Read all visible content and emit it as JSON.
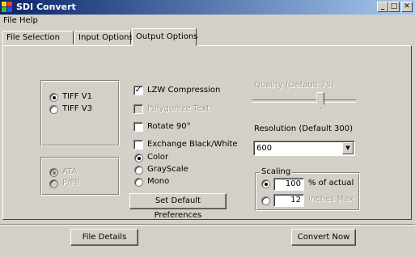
{
  "window": {
    "title": "SDI Convert",
    "minimize": "_",
    "maximize": "□",
    "close": "✕"
  },
  "menu": {
    "file": "File",
    "help": "Help"
  },
  "tabs": [
    {
      "label": "File Selection"
    },
    {
      "label": "Input Options"
    },
    {
      "label": "Output Options",
      "active": true
    }
  ],
  "format": {
    "tiff_v1": {
      "label": "TIFF V1",
      "checked": true
    },
    "tiff_v3": {
      "label": "TIFF V3",
      "checked": false
    }
  },
  "ata": {
    "ata": {
      "label": "ATA",
      "checked": true,
      "disabled": true
    },
    "pipii": {
      "label": "P/PII",
      "checked": false,
      "disabled": true
    }
  },
  "options": {
    "lzw": {
      "label": "LZW Compression",
      "checked": true
    },
    "polygonize": {
      "label": "Polygonize Text",
      "checked": false,
      "disabled": true
    },
    "rotate": {
      "label": "Rotate 90°",
      "checked": false
    },
    "exchange": {
      "label": "Exchange Black/White",
      "checked": false
    }
  },
  "color_mode": {
    "color": {
      "label": "Color",
      "checked": true
    },
    "grayscale": {
      "label": "GrayScale",
      "checked": false
    },
    "mono": {
      "label": "Mono",
      "checked": false
    }
  },
  "set_default_button": "Set Default Preferences",
  "quality": {
    "label": "Quality (Default 75)",
    "value_fraction": 0.66,
    "disabled": true
  },
  "resolution": {
    "label": "Resolution (Default 300)",
    "value": "600"
  },
  "scaling": {
    "title": "Scaling",
    "percent": {
      "value": "100",
      "label": "% of actual",
      "checked": true
    },
    "inches": {
      "value": "12",
      "label": "Inches Max",
      "checked": false
    }
  },
  "footer": {
    "file_details": "File Details",
    "convert_now": "Convert Now"
  }
}
